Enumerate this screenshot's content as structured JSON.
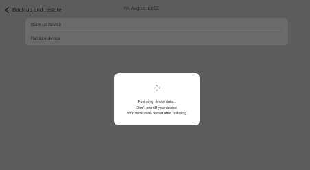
{
  "header": {
    "title": "Back up and restore",
    "back_icon": "chevron-left-icon",
    "datetime": "Fri, Aug 11, 13:58"
  },
  "list": {
    "items": [
      {
        "label": "Back up device"
      },
      {
        "label": "Restore device"
      }
    ]
  },
  "dialog": {
    "spinner_icon": "loading-spinner-icon",
    "lines": [
      "Restoring device data...",
      "Don't turn off your device.",
      "Your device will restart after restoring."
    ]
  },
  "colors": {
    "scrim_background": "#5c5c5c",
    "list_background": "#6b6b6b",
    "dialog_background": "#ffffff",
    "text_dark": "#1e1e1e"
  }
}
